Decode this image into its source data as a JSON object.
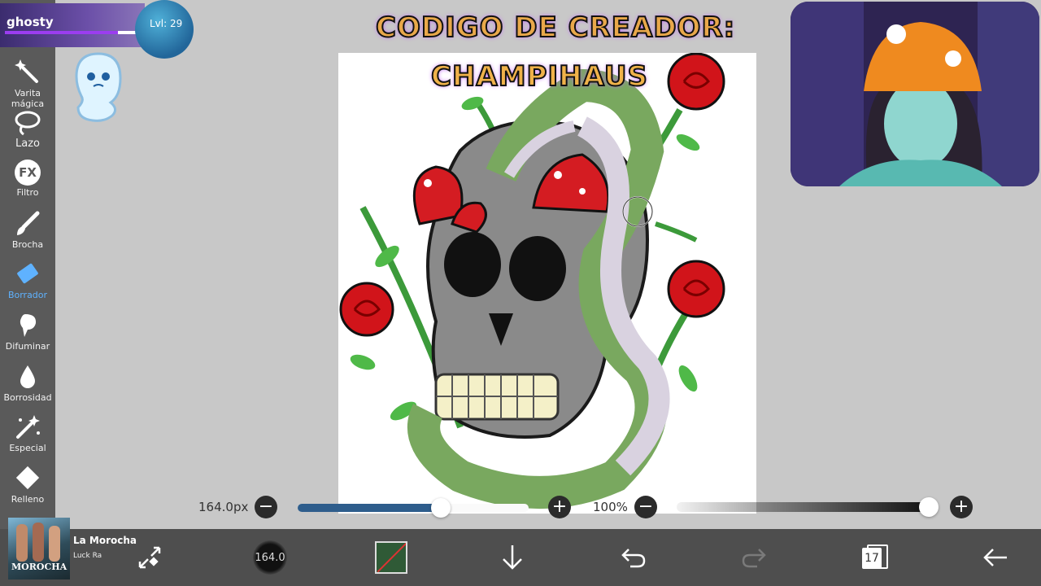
{
  "overlay": {
    "username": "ghosty",
    "level_label": "Lvl: 29",
    "level_progress": 0.82
  },
  "overlay_title": {
    "line1": "CODIGO DE CREADOR:",
    "line2": "CHAMPIHAUS"
  },
  "sidebar": {
    "tools": [
      {
        "label": "Varita mágica",
        "icon": "magic-wand-icon"
      },
      {
        "label": "Lazo",
        "icon": "lasso-icon"
      },
      {
        "label": "Filtro",
        "icon": "fx-icon",
        "glyph": "FX"
      },
      {
        "label": "Brocha",
        "icon": "brush-icon"
      },
      {
        "label": "Borrador",
        "icon": "eraser-icon",
        "active": true
      },
      {
        "label": "Difuminar",
        "icon": "smudge-icon"
      },
      {
        "label": "Borrosidad",
        "icon": "blur-drop-icon"
      },
      {
        "label": "Especial",
        "icon": "special-wand-icon"
      },
      {
        "label": "Relleno",
        "icon": "fill-icon"
      }
    ]
  },
  "brush_size": {
    "label": "164.0px",
    "fraction": 0.62
  },
  "opacity": {
    "label": "100%",
    "fraction": 1.0
  },
  "now_playing": {
    "title": "La Morocha",
    "artist": "Luck Ra",
    "album_text": "MOROCHA"
  },
  "bottom_bar": {
    "brush_preview_label": "164.0",
    "layers_count": "17"
  },
  "colors": {
    "accent": "#5fb2ff",
    "slider_fill": "#2e5d8c",
    "toolbar_bg": "#4e4e4e",
    "sidebar_bg": "#5a5a5a",
    "workspace_bg": "#c8c8c8",
    "current_color": "#2f5a36"
  }
}
